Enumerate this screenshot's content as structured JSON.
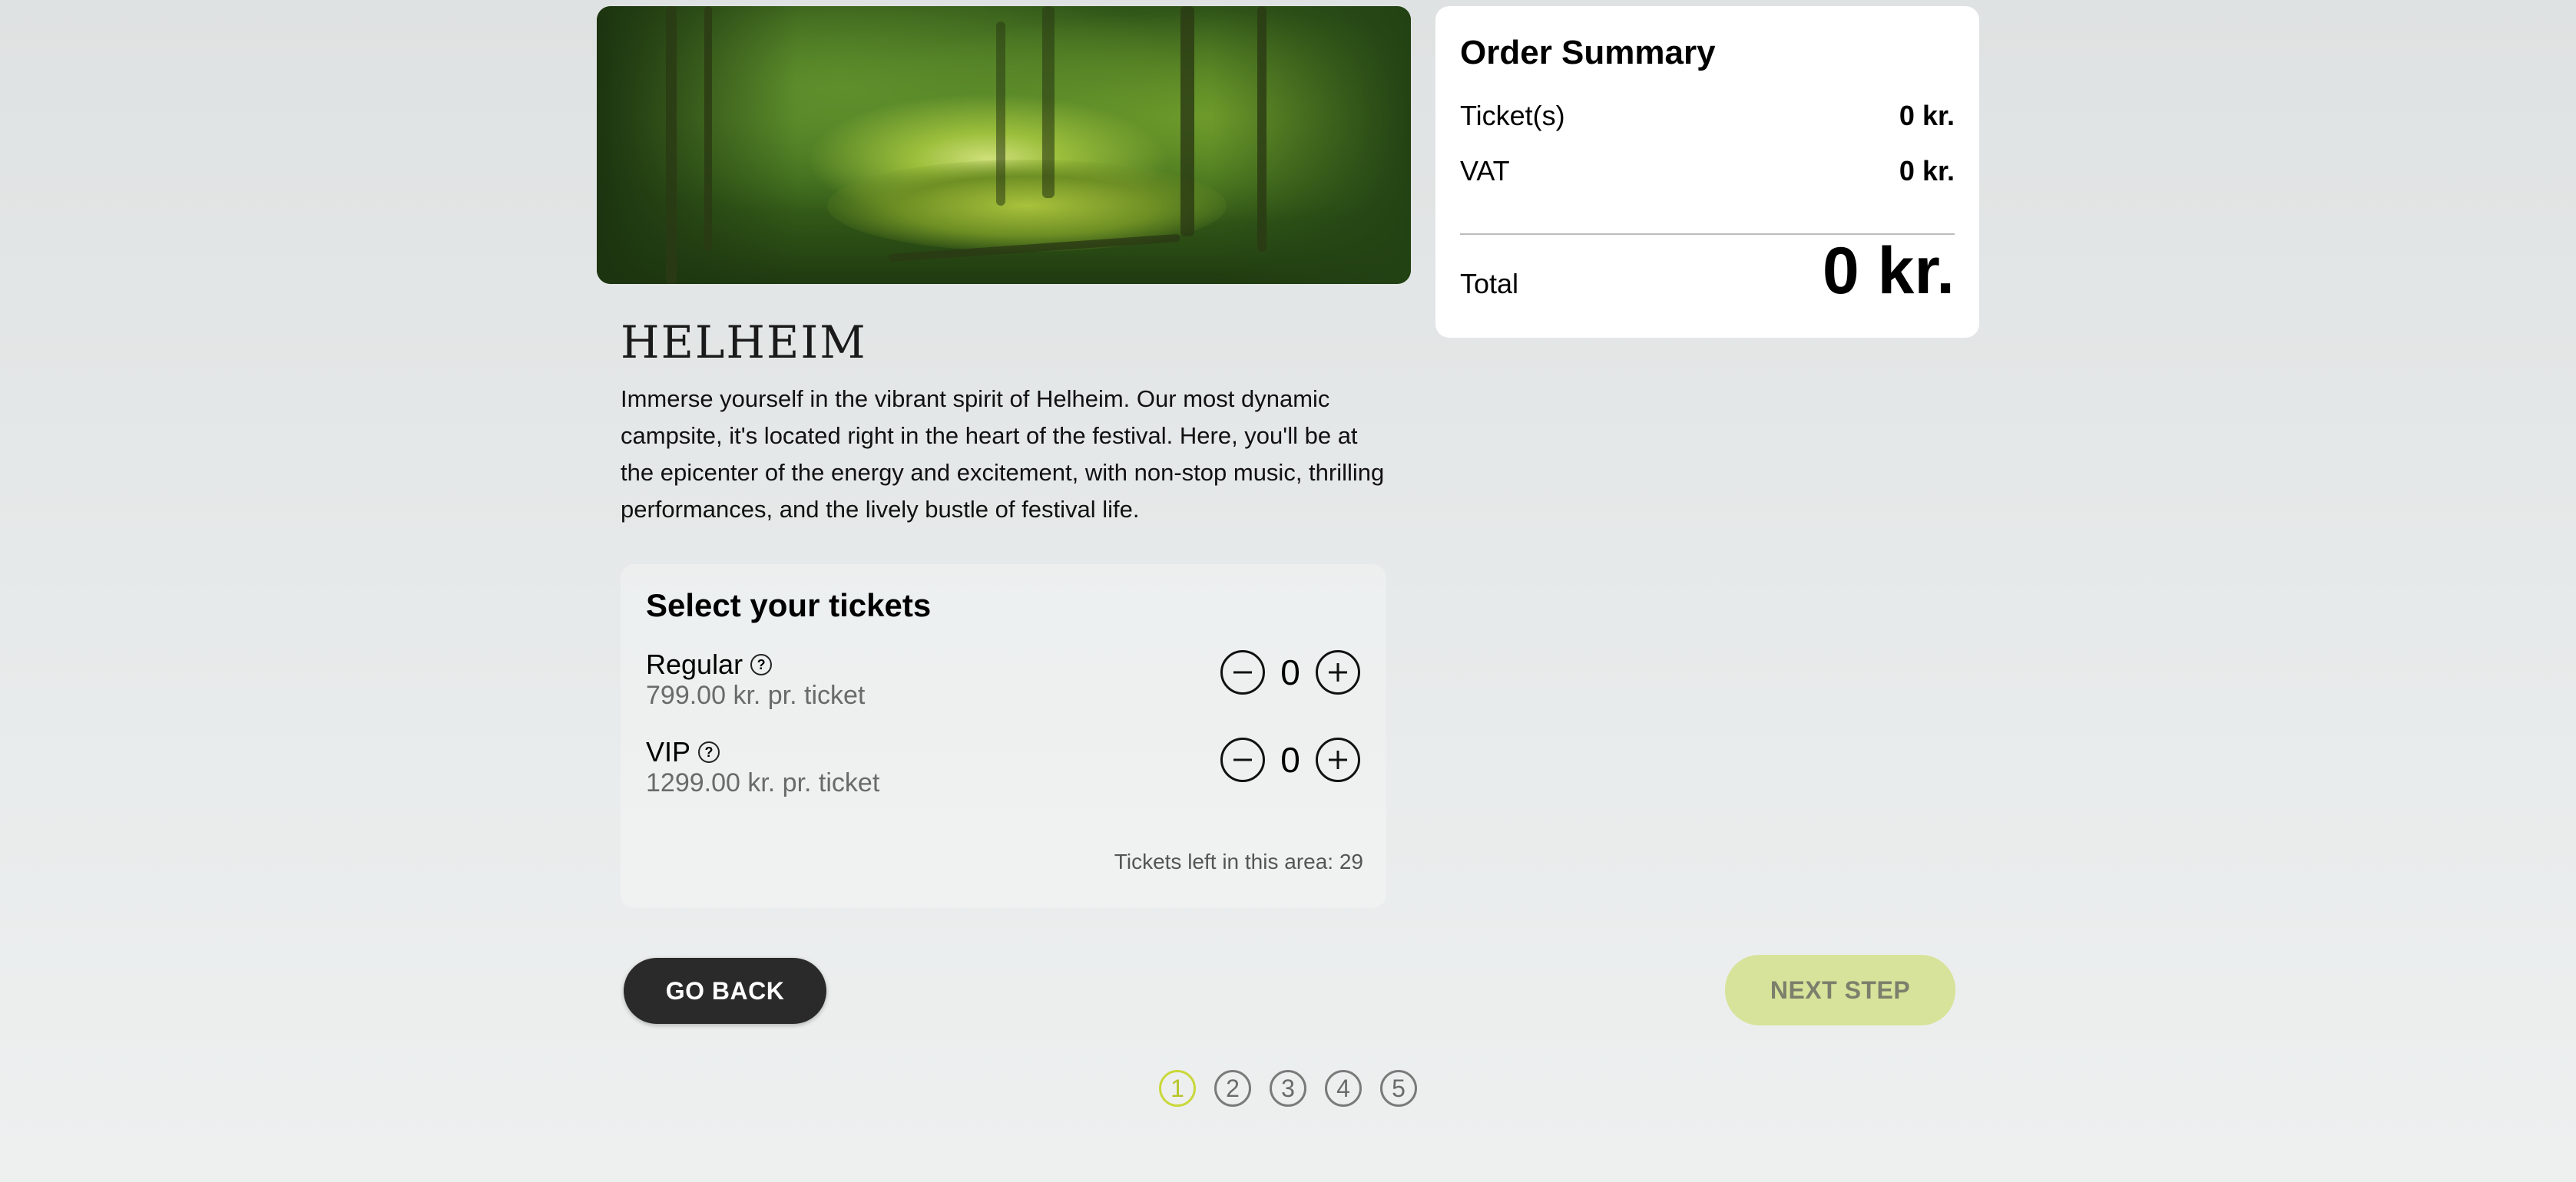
{
  "hero": {
    "image": "forest-river-photo"
  },
  "campsite": {
    "name": "HELHEIM",
    "description": "Immerse yourself in the vibrant spirit of Helheim. Our most dynamic campsite, it's located right in the heart of the festival. Here, you'll be at the epicenter of the energy and excitement, with non-stop music, thrilling performances, and the lively bustle of festival life."
  },
  "tickets": {
    "heading": "Select your tickets",
    "items": [
      {
        "name": "Regular",
        "price": "799.00 kr. pr. ticket",
        "quantity": "0",
        "help_icon": "question-circle-icon"
      },
      {
        "name": "VIP",
        "price": "1299.00 kr. pr. ticket",
        "quantity": "0",
        "help_icon": "question-circle-icon"
      }
    ],
    "tickets_left": "Tickets left in this area: 29"
  },
  "summary": {
    "heading": "Order Summary",
    "tickets_label": "Ticket(s)",
    "tickets_value": "0 kr.",
    "vat_label": "VAT",
    "vat_value": "0 kr.",
    "total_label": "Total",
    "total_value": "0 kr."
  },
  "actions": {
    "back_label": "GO BACK",
    "next_label": "NEXT STEP"
  },
  "steps": {
    "items": [
      "1",
      "2",
      "3",
      "4",
      "5"
    ],
    "active": 1
  },
  "colors": {
    "accent": "#c9d83a",
    "next_button_bg": "#d7e39a",
    "back_button_bg": "#2a2a2a"
  }
}
